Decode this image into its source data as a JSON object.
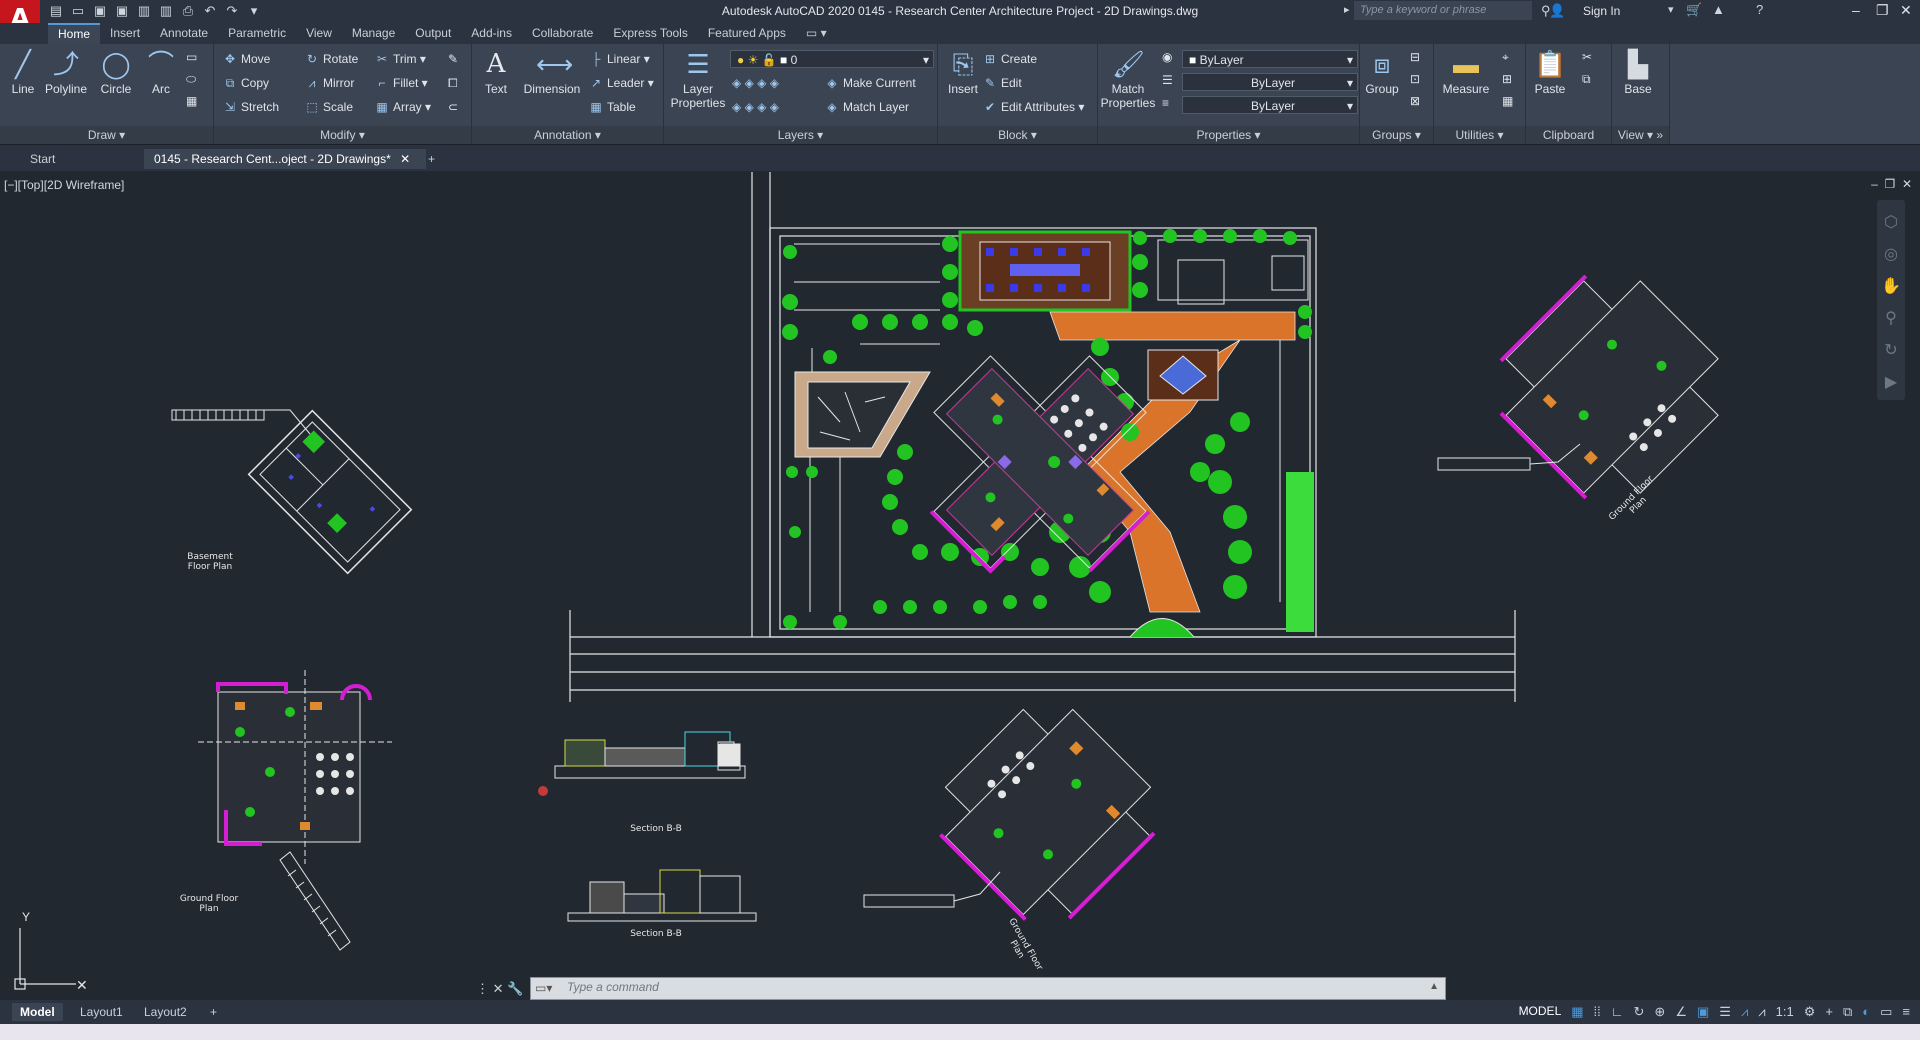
{
  "app": {
    "logo": "A",
    "window_title": "Autodesk AutoCAD 2020    0145 - Research Center  Architecture Project - 2D Drawings.dwg",
    "search_placeholder": "Type a keyword or phrase",
    "sign_in": "Sign In"
  },
  "ribbon_tabs": [
    "Home",
    "Insert",
    "Annotate",
    "Parametric",
    "View",
    "Manage",
    "Output",
    "Add-ins",
    "Collaborate",
    "Express Tools",
    "Featured Apps"
  ],
  "active_tab": "Home",
  "panels": {
    "draw": {
      "title": "Draw",
      "line": "Line",
      "polyline": "Polyline",
      "circle": "Circle",
      "arc": "Arc"
    },
    "modify": {
      "title": "Modify",
      "move": "Move",
      "rotate": "Rotate",
      "trim": "Trim",
      "copy": "Copy",
      "mirror": "Mirror",
      "fillet": "Fillet",
      "stretch": "Stretch",
      "scale": "Scale",
      "array": "Array"
    },
    "annotation": {
      "title": "Annotation",
      "text": "Text",
      "dimension": "Dimension",
      "linear": "Linear",
      "leader": "Leader",
      "table": "Table"
    },
    "layers": {
      "title": "Layers",
      "layer_properties": "Layer Properties",
      "current_layer": "0",
      "make_current": "Make Current",
      "match_layer": "Match Layer"
    },
    "block": {
      "title": "Block",
      "insert": "Insert",
      "create": "Create",
      "edit": "Edit",
      "edit_attributes": "Edit Attributes"
    },
    "properties": {
      "title": "Properties",
      "match_properties": "Match Properties",
      "color": "ByLayer",
      "linetype": "ByLayer",
      "lineweight": "ByLayer"
    },
    "groups": {
      "title": "Groups",
      "group": "Group"
    },
    "utilities": {
      "title": "Utilities",
      "measure": "Measure"
    },
    "clipboard": {
      "title": "Clipboard",
      "paste": "Paste"
    },
    "view": {
      "title": "View",
      "base": "Base"
    }
  },
  "doc_tabs": [
    "Start",
    "0145 - Research Cent...oject - 2D Drawings*"
  ],
  "viewport": {
    "label": "[−][Top][2D Wireframe]"
  },
  "plan_labels": {
    "basement": "Basement\nFloor Plan",
    "ground_left": "Ground Floor\nPlan",
    "ground_right": "Ground Floor\nPlan",
    "ground_bottom": "Ground Floor\nPlan",
    "section_b": "Section B-B",
    "section_b2": "Section B-B"
  },
  "command_line": {
    "placeholder": "Type a command"
  },
  "layout_tabs": [
    "Model",
    "Layout1",
    "Layout2"
  ],
  "status": {
    "model": "MODEL",
    "scale": "1:1"
  },
  "colors": {
    "accent": "#4f9ad9",
    "magenta": "#d41ed4",
    "tree_green": "#22c422",
    "orange": "#d9742a",
    "logo_red": "#c4161c"
  }
}
